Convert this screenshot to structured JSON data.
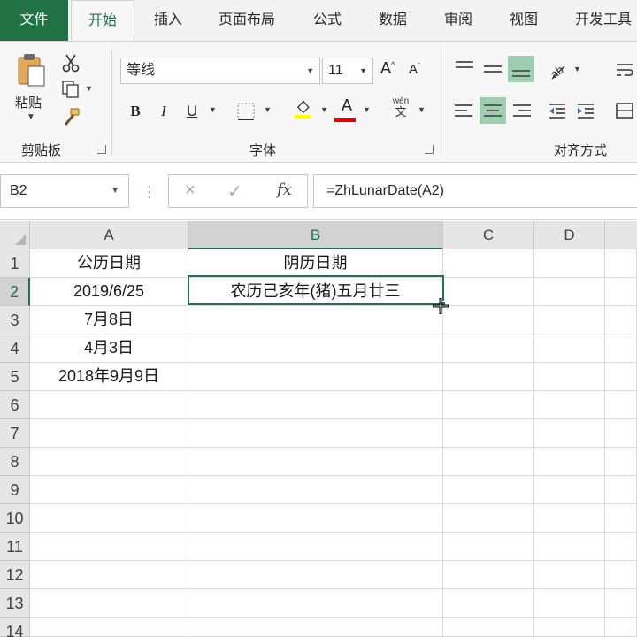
{
  "ribbon_tabs": {
    "file": "文件",
    "home": "开始",
    "insert": "插入",
    "page_layout": "页面布局",
    "formulas": "公式",
    "data": "数据",
    "review": "审阅",
    "view": "视图",
    "developer": "开发工具"
  },
  "clipboard": {
    "paste_label": "粘贴",
    "group_label": "剪贴板"
  },
  "font": {
    "font_name": "等线",
    "font_size": "11",
    "bold": "B",
    "italic": "I",
    "underline": "U",
    "phonetic_top": "wén",
    "phonetic_bottom": "文",
    "group_label": "字体",
    "font_color": "#e00000",
    "highlight_color": "#ffff00"
  },
  "alignment": {
    "group_label": "对齐方式"
  },
  "formula_bar": {
    "name_box": "B2",
    "cancel_icon": "×",
    "enter_icon": "✓",
    "fx_label": "fx",
    "formula": "=ZhLunarDate(A2)"
  },
  "grid": {
    "columns": [
      "A",
      "B",
      "C",
      "D"
    ],
    "rows": [
      "1",
      "2",
      "3",
      "4",
      "5",
      "6",
      "7",
      "8",
      "9",
      "10",
      "11",
      "12",
      "13",
      "14"
    ],
    "cells": {
      "A1": "公历日期",
      "B1": "阴历日期",
      "A2": "2019/6/25",
      "B2": "农历己亥年(猪)五月廿三",
      "A3": "7月8日",
      "A4": "4月3日",
      "A5": "2018年9月9日"
    },
    "selected_cell": "B2"
  },
  "colors": {
    "accent": "#217346",
    "active_align": "#9bcfb0"
  }
}
